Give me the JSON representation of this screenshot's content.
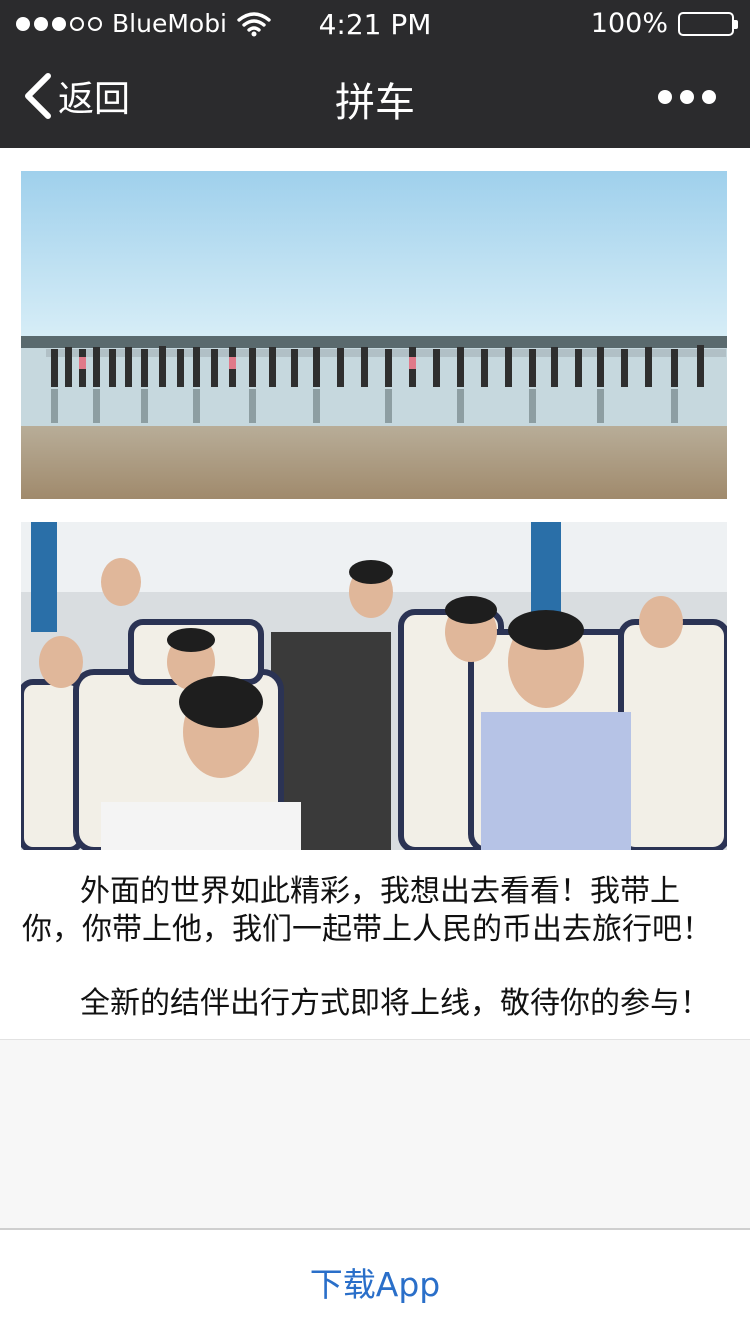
{
  "status_bar": {
    "carrier": "BlueMobi",
    "time": "4:21 PM",
    "battery": "100%",
    "signal_bars_filled": 3,
    "signal_bars_total": 5
  },
  "nav": {
    "back_label": "返回",
    "title": "拼车"
  },
  "article": {
    "paragraph1": "外面的世界如此精彩，我想出去看看！我带上你，你带上他，我们一起带上人民的币出去旅行吧！",
    "paragraph2": "全新的结伴出行方式即将上线，敬待你的参与！"
  },
  "footer": {
    "download_label": "下载App"
  },
  "colors": {
    "nav_background": "#2b2b2d",
    "link_blue": "#2a6fc9",
    "page_background": "#f7f7f7"
  },
  "icons": {
    "back": "chevron-left-icon",
    "more": "more-dots-icon",
    "wifi": "wifi-icon",
    "battery": "battery-icon"
  }
}
